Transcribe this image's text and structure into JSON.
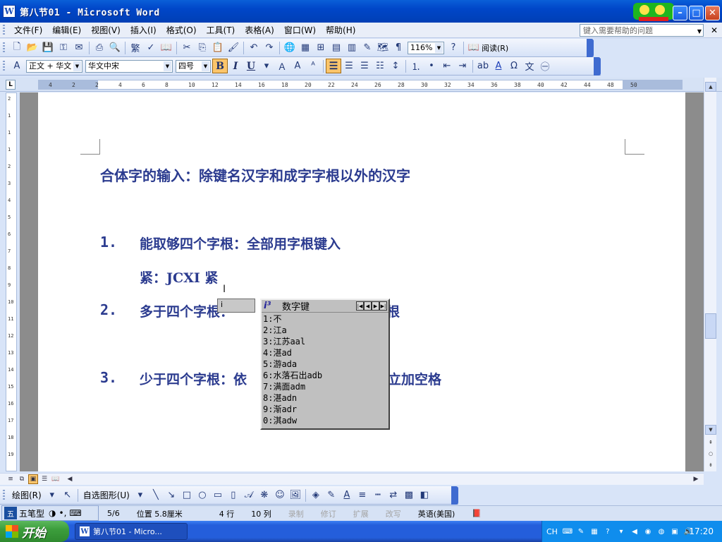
{
  "window": {
    "title": "第八节01 - Microsoft Word"
  },
  "menubar": {
    "items": [
      "文件(F)",
      "编辑(E)",
      "视图(V)",
      "插入(I)",
      "格式(O)",
      "工具(T)",
      "表格(A)",
      "窗口(W)",
      "帮助(H)"
    ],
    "help_placeholder": "键入需要帮助的问题"
  },
  "toolbar1": {
    "zoom": "116%",
    "read_label": "阅读(R)"
  },
  "toolbar2": {
    "style": "正文 + 华文",
    "font": "华文中宋",
    "size": "四号",
    "bold_label": "B",
    "italic_label": "I",
    "underline_label": "U"
  },
  "ruler": {
    "h_ticks": [
      "4",
      "2",
      "2",
      "4",
      "6",
      "8",
      "10",
      "12",
      "14",
      "16",
      "18",
      "20",
      "22",
      "24",
      "26",
      "28",
      "30",
      "32",
      "34",
      "36",
      "38",
      "40",
      "42",
      "44",
      "48",
      "50"
    ],
    "v_ticks": [
      "2",
      "1",
      "1",
      "1",
      "2",
      "3",
      "4",
      "5",
      "6",
      "7",
      "8",
      "9",
      "10",
      "11",
      "12",
      "13",
      "14",
      "15",
      "16",
      "17",
      "18",
      "19"
    ]
  },
  "document": {
    "heading": "合体字的输入：除键名汉字和成字字根以外的汉字",
    "items": [
      {
        "num": "1.",
        "text": "能取够四个字根：全部用字根键入"
      },
      {
        "num": "",
        "text": "紧：JCXI 紧"
      },
      {
        "num": "2.",
        "text": "多于四个字根："
      },
      {
        "num": "3.",
        "text": "少于四个字根：依"
      }
    ],
    "item2_tail": "根",
    "item3_tail": "立加空格"
  },
  "ime": {
    "input_text": "i",
    "candidate_title": "数字键",
    "candidates": [
      "1:不",
      "2:江a",
      "3:江苏aal",
      "4:湛ad",
      "5:游ada",
      "6:水落石出adb",
      "7:满面adm",
      "8:湛adn",
      "9:渐adr",
      "0:淇adw"
    ]
  },
  "drawbar": {
    "draw_label": "绘图(R)",
    "autoshape_label": "自选图形(U)"
  },
  "imebar": {
    "name": "五笔型"
  },
  "statusbar": {
    "page": "5/6",
    "position": "位置 5.8厘米",
    "line": "4 行",
    "col": "10 列",
    "rec": "录制",
    "trk": "修订",
    "ext": "扩展",
    "ovr": "改写",
    "lang": "英语(美国)"
  },
  "taskbar": {
    "start_label": "开始",
    "task_item": "第八节01 - Micro...",
    "lang_indicator": "CH",
    "clock": "17:20"
  },
  "colors": {
    "doc_text": "#2b3b8f",
    "title_bar": "#0046c8",
    "taskbar": "#245edb"
  }
}
